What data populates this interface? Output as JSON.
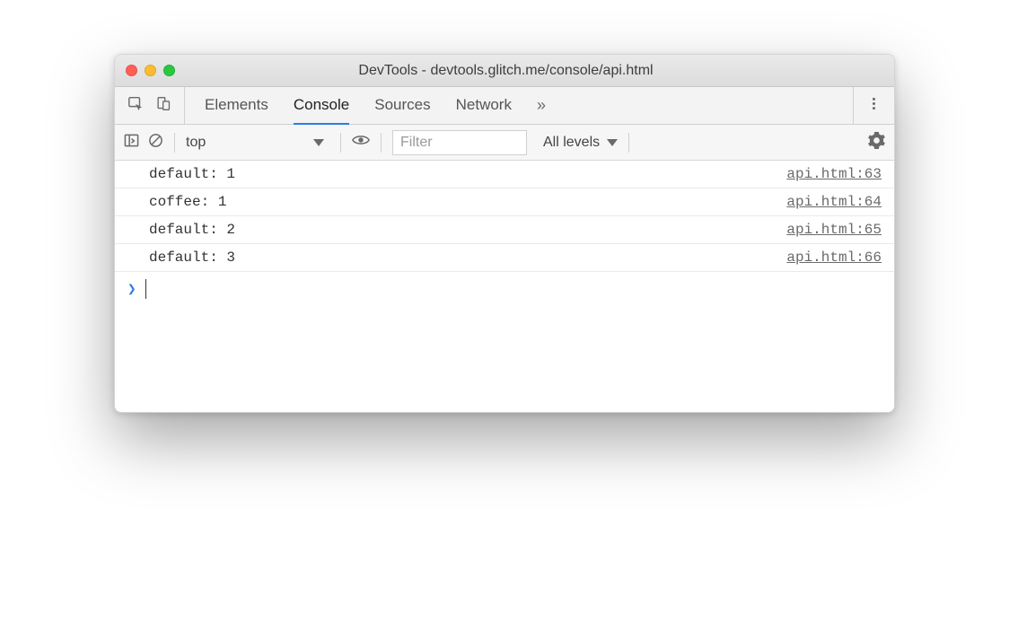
{
  "window": {
    "title": "DevTools - devtools.glitch.me/console/api.html"
  },
  "tabs": {
    "items": [
      "Elements",
      "Console",
      "Sources",
      "Network"
    ],
    "active_index": 1,
    "overflow": "»"
  },
  "console_toolbar": {
    "context": "top",
    "filter_placeholder": "Filter",
    "levels_label": "All levels"
  },
  "logs": [
    {
      "message": "default: 1",
      "source": "api.html:63"
    },
    {
      "message": "coffee: 1",
      "source": "api.html:64"
    },
    {
      "message": "default: 2",
      "source": "api.html:65"
    },
    {
      "message": "default: 3",
      "source": "api.html:66"
    }
  ],
  "prompt": {
    "caret": "❯",
    "value": ""
  }
}
